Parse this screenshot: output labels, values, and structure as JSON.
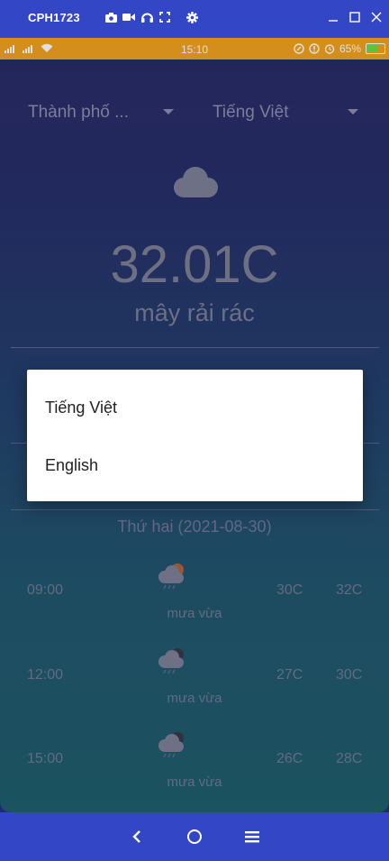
{
  "host": {
    "title": "CPH1723",
    "tool_icons": [
      "camera-icon",
      "video-icon",
      "headphones-icon",
      "fullscreen-icon",
      "gear-icon"
    ],
    "window_controls": [
      "minimize-icon",
      "maximize-icon",
      "close-icon"
    ]
  },
  "status_bar": {
    "time": "15:10",
    "battery": "65%",
    "battery_level": 0.65,
    "colors": {
      "background": "#f2a21f"
    }
  },
  "app": {
    "city_dropdown": "Thành phố ...",
    "language_dropdown": "Tiếng Việt",
    "current_icon": "cloud-icon",
    "temperature": "32.01C",
    "description": "mây rải rác",
    "day_header": "Thứ hai (2021-08-30)",
    "forecast": [
      {
        "time": "09:00",
        "icon": "rain-sun-icon",
        "desc": "mưa vừa",
        "min": "30C",
        "max": "32C"
      },
      {
        "time": "12:00",
        "icon": "rain-moon-icon",
        "desc": "mưa vừa",
        "min": "27C",
        "max": "30C"
      },
      {
        "time": "15:00",
        "icon": "rain-moon-icon",
        "desc": "mưa vừa",
        "min": "26C",
        "max": "28C"
      }
    ]
  },
  "dialog": {
    "options": [
      "Tiếng Việt",
      "English"
    ]
  },
  "navbar": {
    "icons": [
      "back-icon",
      "home-icon",
      "menu-icon"
    ]
  }
}
